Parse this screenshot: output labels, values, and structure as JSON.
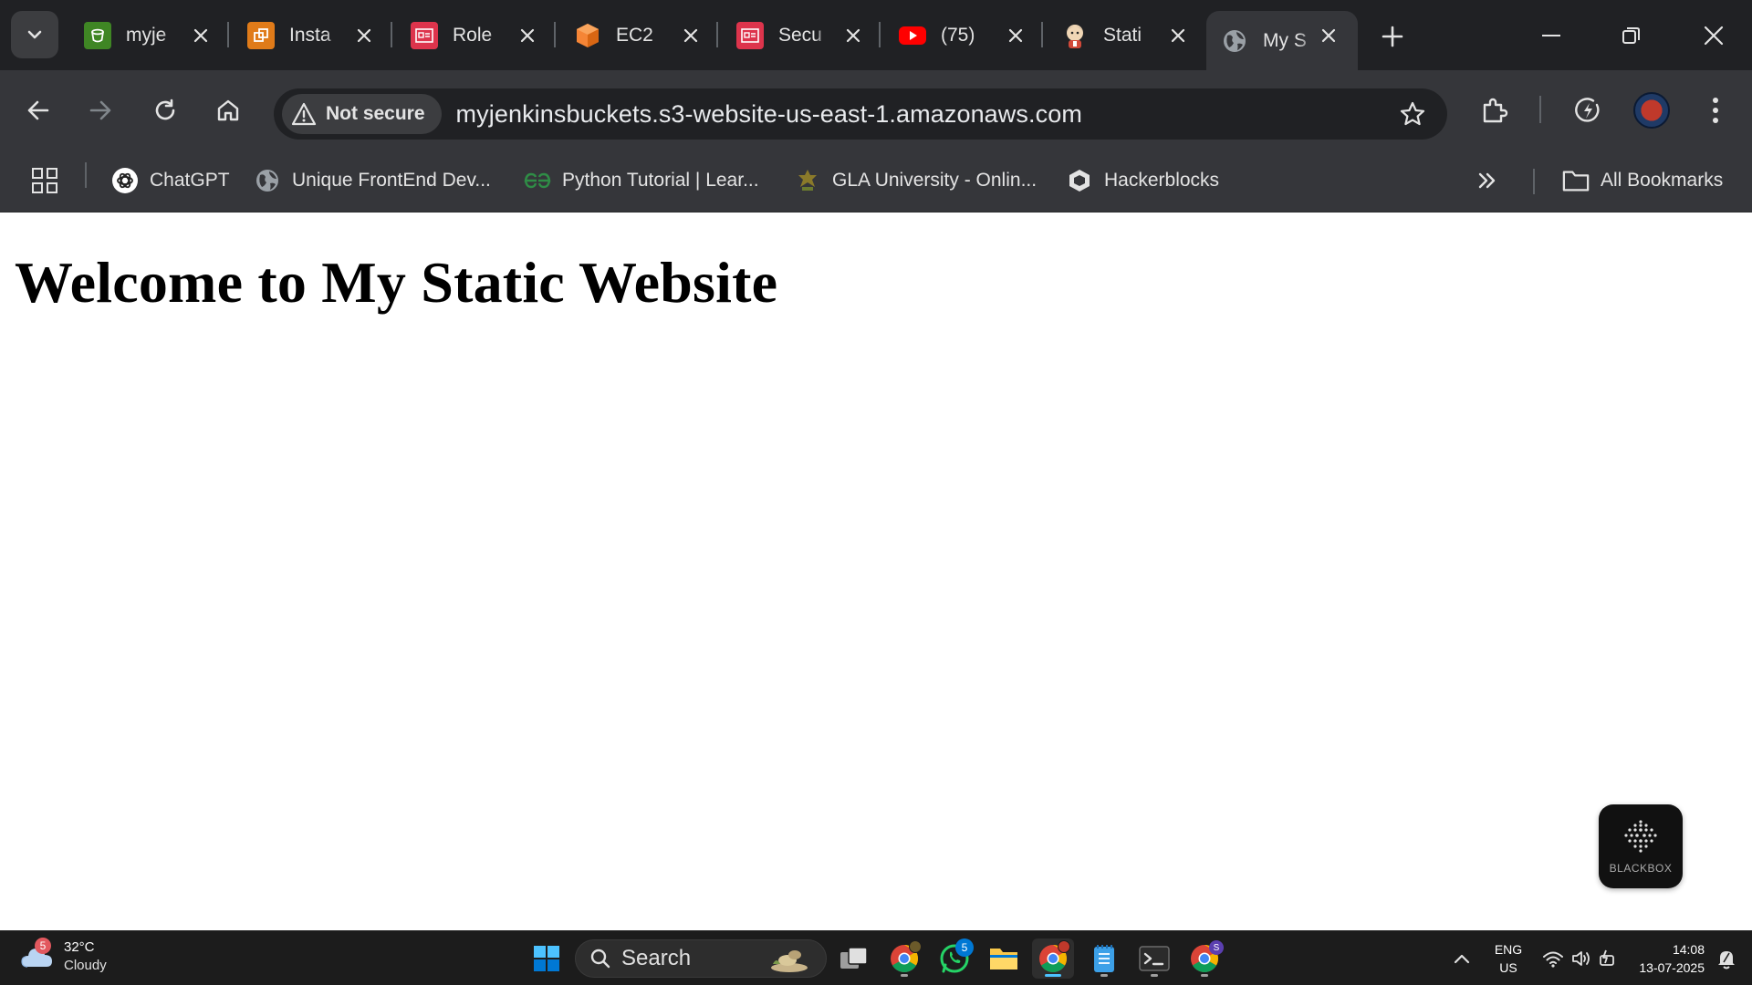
{
  "browser": {
    "tabs": [
      {
        "title": "myje",
        "icon": "s3-bucket-icon",
        "color": "#3f8624"
      },
      {
        "title": "Insta",
        "icon": "instances-icon",
        "color": "#e07b19"
      },
      {
        "title": "Role",
        "icon": "iam-role-icon",
        "color": "#dd344c"
      },
      {
        "title": "EC2",
        "icon": "ec2-cube-icon",
        "color": "#f58536"
      },
      {
        "title": "Secu",
        "icon": "security-group-icon",
        "color": "#dd344c"
      },
      {
        "title": "(75)",
        "icon": "youtube-icon",
        "color": "#ff0000"
      },
      {
        "title": "Stati",
        "icon": "jenkins-icon",
        "color": "#d24939"
      },
      {
        "title": "My S",
        "icon": "globe-icon",
        "color": "#9aa0a6",
        "active": true
      }
    ],
    "security_chip": "Not secure",
    "url": "myjenkinsbuckets.s3-website-us-east-1.amazonaws.com",
    "bookmarks": [
      {
        "label": "ChatGPT",
        "icon": "chatgpt-icon"
      },
      {
        "label": "Unique FrontEnd Dev...",
        "icon": "globe-icon"
      },
      {
        "label": "Python Tutorial | Lear...",
        "icon": "geeksforgeeks-icon"
      },
      {
        "label": "GLA University - Onlin...",
        "icon": "gla-icon"
      },
      {
        "label": "Hackerblocks",
        "icon": "hackerblocks-icon"
      }
    ],
    "all_bookmarks": "All Bookmarks"
  },
  "page": {
    "heading": "Welcome to My Static Website",
    "blackbox_label": "BLACKBOX"
  },
  "taskbar": {
    "weather": {
      "temp": "32°C",
      "condition": "Cloudy",
      "badge": "5"
    },
    "search_label": "Search",
    "whatsapp_badge": "5",
    "chrome_badge": "S",
    "lang_top": "ENG",
    "lang_bottom": "US",
    "time": "14:08",
    "date": "13-07-2025"
  },
  "colors": {
    "tabstrip_bg": "#202124",
    "toolbar_bg": "#35363a",
    "page_bg": "#ffffff",
    "taskbar_bg": "#1c1c1c"
  }
}
